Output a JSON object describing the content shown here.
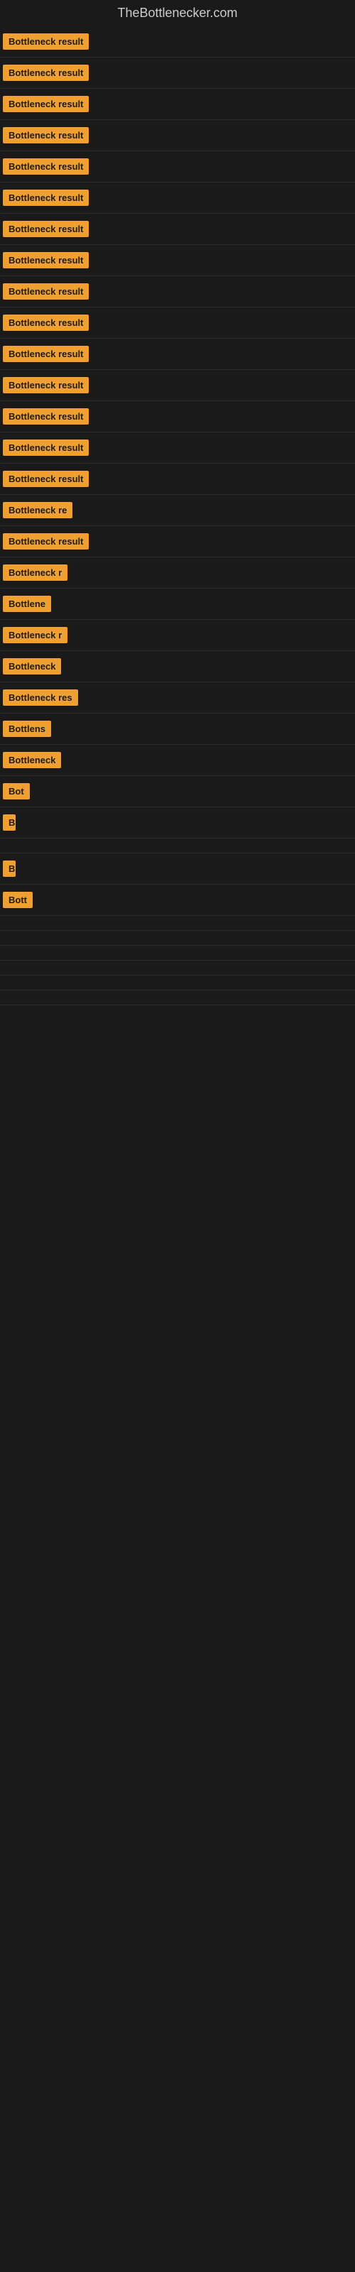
{
  "site": {
    "title": "TheBottlenecker.com"
  },
  "rows": [
    {
      "label": "Bottleneck result",
      "maxWidth": 160
    },
    {
      "label": "Bottleneck result",
      "maxWidth": 155
    },
    {
      "label": "Bottleneck result",
      "maxWidth": 150
    },
    {
      "label": "Bottleneck result",
      "maxWidth": 150
    },
    {
      "label": "Bottleneck result",
      "maxWidth": 148
    },
    {
      "label": "Bottleneck result",
      "maxWidth": 148
    },
    {
      "label": "Bottleneck result",
      "maxWidth": 145
    },
    {
      "label": "Bottleneck result",
      "maxWidth": 145
    },
    {
      "label": "Bottleneck result",
      "maxWidth": 143
    },
    {
      "label": "Bottleneck result",
      "maxWidth": 143
    },
    {
      "label": "Bottleneck result",
      "maxWidth": 140
    },
    {
      "label": "Bottleneck result",
      "maxWidth": 138
    },
    {
      "label": "Bottleneck result",
      "maxWidth": 135
    },
    {
      "label": "Bottleneck result",
      "maxWidth": 133
    },
    {
      "label": "Bottleneck result",
      "maxWidth": 130
    },
    {
      "label": "Bottleneck re",
      "maxWidth": 110
    },
    {
      "label": "Bottleneck result",
      "maxWidth": 128
    },
    {
      "label": "Bottleneck r",
      "maxWidth": 100
    },
    {
      "label": "Bottlene",
      "maxWidth": 80
    },
    {
      "label": "Bottleneck r",
      "maxWidth": 100
    },
    {
      "label": "Bottleneck",
      "maxWidth": 90
    },
    {
      "label": "Bottleneck res",
      "maxWidth": 112
    },
    {
      "label": "Bottlens",
      "maxWidth": 78
    },
    {
      "label": "Bottleneck",
      "maxWidth": 88
    },
    {
      "label": "Bot",
      "maxWidth": 40
    },
    {
      "label": "B",
      "maxWidth": 18
    },
    {
      "label": "",
      "maxWidth": 0
    },
    {
      "label": "B",
      "maxWidth": 18
    },
    {
      "label": "Bott",
      "maxWidth": 44
    },
    {
      "label": "",
      "maxWidth": 0
    },
    {
      "label": "",
      "maxWidth": 0
    },
    {
      "label": "",
      "maxWidth": 0
    },
    {
      "label": "",
      "maxWidth": 0
    },
    {
      "label": "",
      "maxWidth": 0
    },
    {
      "label": "",
      "maxWidth": 0
    }
  ]
}
